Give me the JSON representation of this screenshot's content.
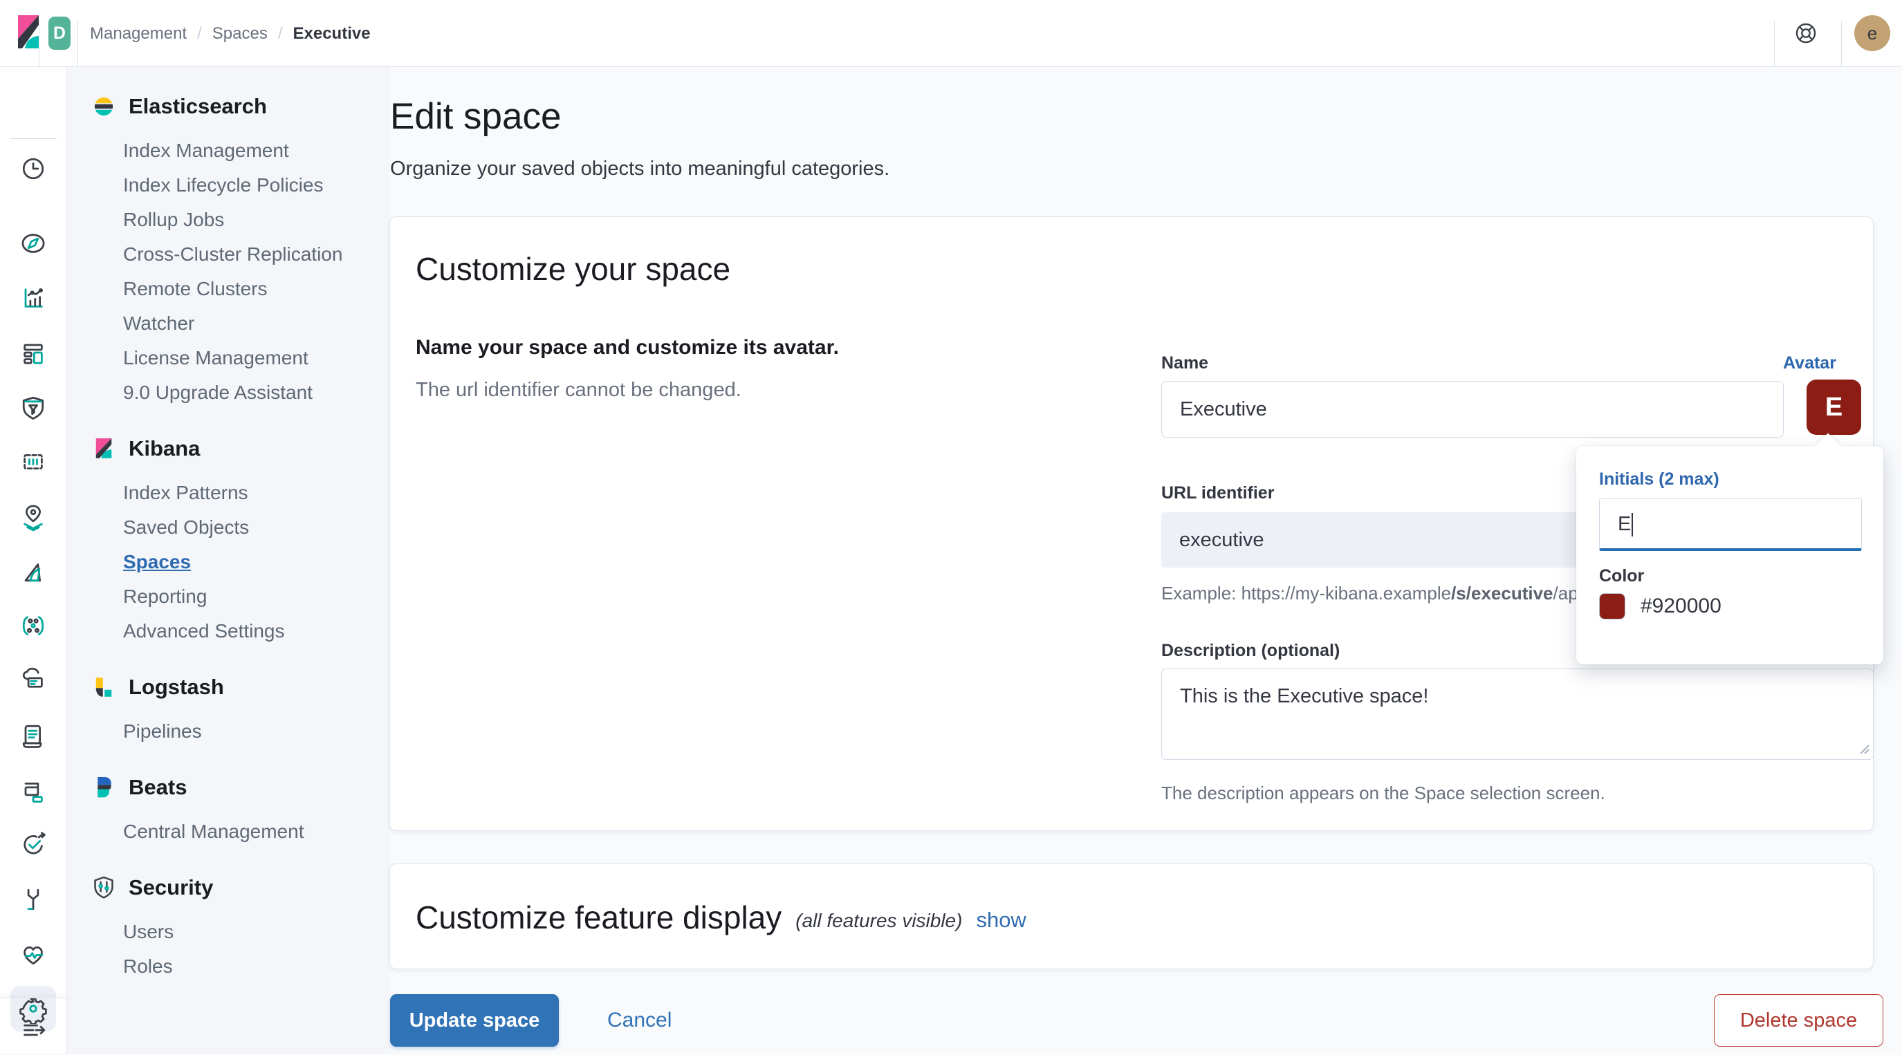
{
  "header": {
    "deployment_badge": "D",
    "breadcrumbs": {
      "b0": "Management",
      "b1": "Spaces",
      "b2": "Executive"
    },
    "user_avatar_initial": "e"
  },
  "nav_rail": {
    "icons": [
      "clock",
      "compass-discover",
      "visualize-chart",
      "dashboard",
      "security-shield",
      "canvas-frame",
      "maps-pin",
      "machine-learning",
      "graph-nodes",
      "enterprise-search",
      "logs-scroll",
      "metrics-windows",
      "uptime-check",
      "dev-tools-wrench",
      "stack-monitoring-heartbeat",
      "stack-management-gear",
      "collapse-menu"
    ],
    "selected": "stack-management-gear"
  },
  "sidebar": {
    "sections": [
      {
        "title": "Elasticsearch",
        "icon": "elasticsearch-logo",
        "items": [
          {
            "label": "Index Management"
          },
          {
            "label": "Index Lifecycle Policies"
          },
          {
            "label": "Rollup Jobs"
          },
          {
            "label": "Cross-Cluster Replication"
          },
          {
            "label": "Remote Clusters"
          },
          {
            "label": "Watcher"
          },
          {
            "label": "License Management"
          },
          {
            "label": "9.0 Upgrade Assistant"
          }
        ]
      },
      {
        "title": "Kibana",
        "icon": "kibana-logo",
        "items": [
          {
            "label": "Index Patterns"
          },
          {
            "label": "Saved Objects"
          },
          {
            "label": "Spaces",
            "active": true
          },
          {
            "label": "Reporting"
          },
          {
            "label": "Advanced Settings"
          }
        ]
      },
      {
        "title": "Logstash",
        "icon": "logstash-logo",
        "items": [
          {
            "label": "Pipelines"
          }
        ]
      },
      {
        "title": "Beats",
        "icon": "beats-logo",
        "items": [
          {
            "label": "Central Management"
          }
        ]
      },
      {
        "title": "Security",
        "icon": "security-shield-logo",
        "items": [
          {
            "label": "Users"
          },
          {
            "label": "Roles"
          }
        ]
      }
    ]
  },
  "page": {
    "title": "Edit space",
    "subtitle": "Organize your saved objects into meaningful categories."
  },
  "customize_panel": {
    "title": "Customize your space",
    "lead": "Name your space and customize its avatar.",
    "lead_sub": "The url identifier cannot be changed.",
    "name_label": "Name",
    "name_value": "Executive",
    "avatar_label": "Avatar",
    "avatar_initial": "E",
    "url_label": "URL identifier",
    "url_value": "executive",
    "url_help_prefix": "Example: https://my-kibana.example",
    "url_help_bold": "/s/executive",
    "url_help_suffix": "/app/",
    "description_label": "Description (optional)",
    "description_value": "This is the Executive space!",
    "description_help": "The description appears on the Space selection screen."
  },
  "avatar_popover": {
    "initials_label": "Initials (2 max)",
    "initials_value": "E",
    "color_label": "Color",
    "color_hex_text": "#920000"
  },
  "features_panel": {
    "title": "Customize feature display",
    "note": "(all features visible)",
    "show_link": "show"
  },
  "actions": {
    "update": "Update space",
    "cancel": "Cancel",
    "delete": "Delete space"
  },
  "colors": {
    "space_color": "#920000",
    "primary_blue": "#3073b7",
    "link_blue": "#2f6bb0",
    "delete_red": "#BD271E",
    "badge_teal": "#54B399",
    "user_avatar_tan": "#C2A272",
    "accent_teal": "#00BFB3"
  }
}
